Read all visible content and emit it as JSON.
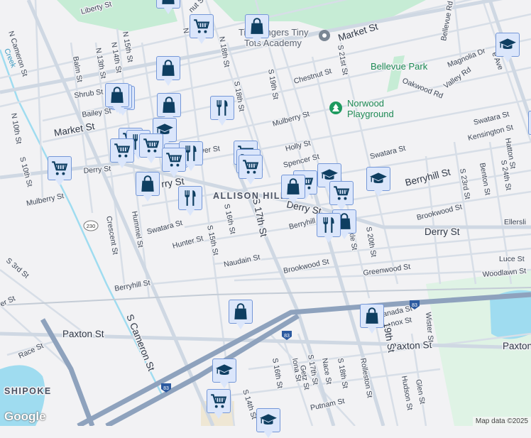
{
  "map": {
    "labels": {
      "liberty": "Liberty St",
      "ncameron": "N Cameron St",
      "market_e": "Market St",
      "chestnut": "Chestnut St",
      "mulberry_e": "Mulberry St",
      "swatara_ne": "Swatara St",
      "kensington": "Kensington St",
      "holly": "Holly St",
      "spencer": "Spencer St",
      "swatara_mid": "Swatara St",
      "berryhill_e": "Berryhill St",
      "derry_mid": "Derry St",
      "derry_e": "Derry St",
      "brookwood_e": "Brookwood St",
      "berryhill_mid": "Berryhill St",
      "brookwood_mid": "Brookwood St",
      "greenwood": "Greenwood St",
      "luce": "Luce St",
      "woodlawn": "Woodlawn St",
      "ellersli": "Ellersli",
      "market_w": "Market St",
      "derry_w": "Derry St",
      "derry_w2": "rry St",
      "mulberry_w": "Mulberry St",
      "swatara_w": "Swatara St",
      "hunter": "Hunter St",
      "naudain": "Naudain St",
      "berryhill_w": "Berryhill St",
      "crescent": "Crescent St",
      "hummel": "Hummel St",
      "s17": "S 17th St",
      "s16": "S 16th St",
      "s15": "S 15th St",
      "s10": "S 10th St",
      "scameron": "S Cameron St",
      "paxton_w": "Paxton St",
      "paxton_mid": "Paxton St",
      "paxton_e": "Paxton",
      "lenox": "Lenox St",
      "granada": "anada St",
      "wister": "Wister St",
      "race": "Race St",
      "putnam": "Putnam St",
      "s14": "S 14th St",
      "s3": "S 3rd St",
      "rolleston": "Rolleston St",
      "s19_s": "19th St",
      "iona": "Iona St",
      "nace": "Nace St",
      "getz": "Getz St",
      "s17_s": "S 17th St",
      "s18_s": "S 18th St",
      "s16_s": "S 16th St",
      "glen": "Glen St",
      "hudson": "Hudson St",
      "s20": "S 20th St",
      "s23": "S 23rd St",
      "benton": "Benton St",
      "s24": "S 24th St",
      "hatton": "Hatton St",
      "n10": "N 10th St",
      "n13": "N 13th St",
      "n14": "N 14th St",
      "n15": "N 15th St",
      "balm": "Balm St",
      "shrub": "Shrub St",
      "bailey": "Bailey St",
      "n18": "N 18th St",
      "s18": "S 18th St",
      "s19": "S 19th St",
      "s21": "S 21st St",
      "oakwood": "Oakwood Rd",
      "valley": "Valley Rd",
      "magnolia": "Magnolia Dr",
      "bellevue_rd": "Bellevue Rd",
      "ave": "e Ave",
      "creek": "Creek",
      "nut": "nut St",
      "n_st": "N",
      "rry": "rry St",
      "kle": "kle St",
      "er": "er St",
      "ver": "ver St"
    },
    "places": {
      "bellevue_park": "Bellevue Park",
      "norwood_1": "Norwood",
      "norwood_2": "Playground",
      "academy_1": "Tiny Fingers Tiny",
      "academy_2": "Tots Academy",
      "allison_hill": "ALLISON HILL",
      "shipoke": "SHIPOKE"
    },
    "shields": {
      "i83_a": "83",
      "i83_b": "83",
      "i83_c": "83",
      "us230": "230"
    },
    "footer": {
      "logo": "Google",
      "attribution": "Map data ©2025"
    },
    "colors": {
      "marker_bg": "#dbe6fb",
      "marker_border": "#7497d8",
      "icon": "#0e3e61",
      "park": "#c3ecd3",
      "water": "#9fdcf0",
      "highway": "#8ea2bd"
    }
  }
}
